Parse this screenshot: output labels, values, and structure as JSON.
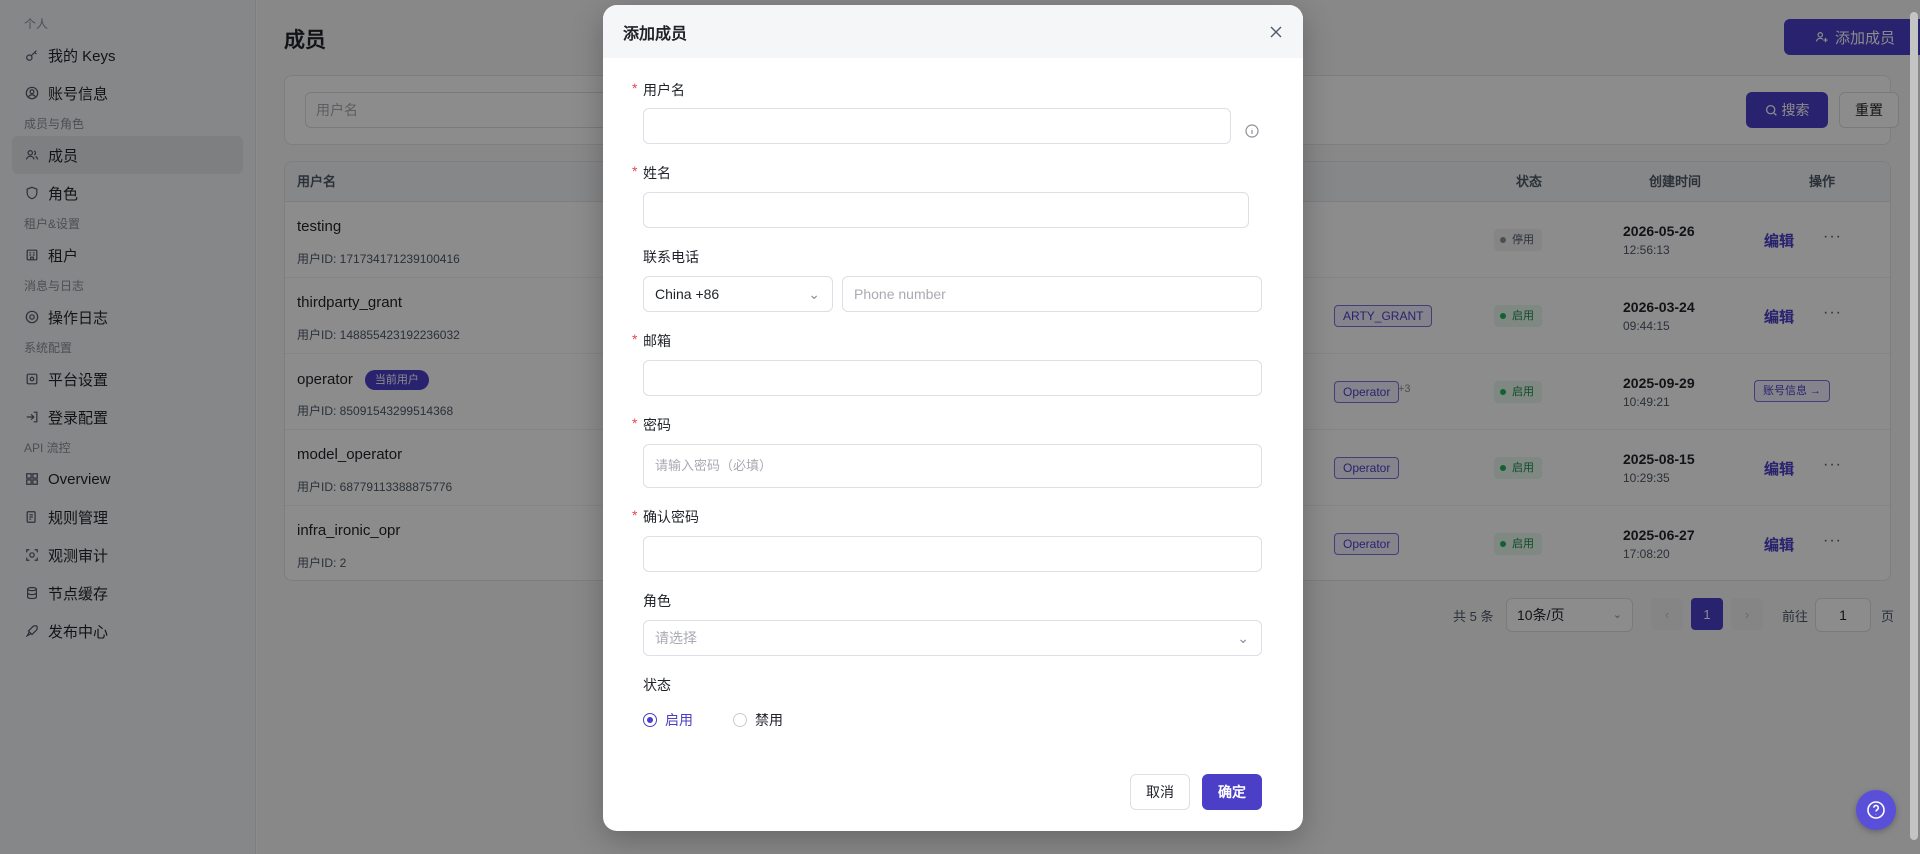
{
  "sidebar": {
    "groups": [
      {
        "label": "个人",
        "items": [
          {
            "label": "我的 Keys",
            "icon": "key-icon"
          },
          {
            "label": "账号信息",
            "icon": "user-circle-icon"
          }
        ]
      },
      {
        "label": "成员与角色",
        "items": [
          {
            "label": "成员",
            "icon": "users-icon",
            "active": true
          },
          {
            "label": "角色",
            "icon": "shield-icon"
          }
        ]
      },
      {
        "label": "租户&设置",
        "items": [
          {
            "label": "租户",
            "icon": "building-icon"
          }
        ]
      },
      {
        "label": "消息与日志",
        "items": [
          {
            "label": "操作日志",
            "icon": "log-icon"
          }
        ]
      },
      {
        "label": "系统配置",
        "items": [
          {
            "label": "平台设置",
            "icon": "settings-icon"
          },
          {
            "label": "登录配置",
            "icon": "login-icon"
          }
        ]
      },
      {
        "label": "API 流控",
        "items": [
          {
            "label": "Overview",
            "icon": "grid-icon"
          },
          {
            "label": "规则管理",
            "icon": "rules-icon"
          },
          {
            "label": "观测审计",
            "icon": "audit-icon"
          },
          {
            "label": "节点缓存",
            "icon": "database-icon"
          },
          {
            "label": "发布中心",
            "icon": "rocket-icon"
          }
        ]
      }
    ]
  },
  "main": {
    "title": "成员",
    "add_button": "添加成员",
    "filter": {
      "username_placeholder": "用户名",
      "search": "搜索",
      "reset": "重置"
    },
    "columns": {
      "username": "用户名",
      "status": "状态",
      "created": "创建时间",
      "actions": "操作"
    },
    "rows": [
      {
        "username": "testing",
        "uid": "用户ID:  171734171239100416",
        "role": "",
        "extra": "",
        "status": "停用",
        "enabled": false,
        "date": "2026-05-26",
        "time": "12:56:13",
        "action": "编辑"
      },
      {
        "username": "thirdparty_grant",
        "uid": "用户ID:  148855423192236032",
        "role": "ARTY_GRANT",
        "extra": "",
        "status": "启用",
        "enabled": true,
        "date": "2026-03-24",
        "time": "09:44:15",
        "action": "编辑"
      },
      {
        "username": "operator",
        "uid": "用户ID:  85091543299514368",
        "tag": "当前用户",
        "role": "Operator",
        "extra": "+3",
        "status": "启用",
        "enabled": true,
        "date": "2025-09-29",
        "time": "10:49:21",
        "action": "账号信息 →"
      },
      {
        "username": "model_operator",
        "uid": "用户ID:  68779113388875776",
        "role": "Operator",
        "extra": "",
        "status": "启用",
        "enabled": true,
        "date": "2025-08-15",
        "time": "10:29:35",
        "action": "编辑"
      },
      {
        "username": "infra_ironic_opr",
        "uid": "用户ID:  2",
        "role": "Operator",
        "extra": "",
        "status": "启用",
        "enabled": true,
        "date": "2025-06-27",
        "time": "17:08:20",
        "action": "编辑"
      }
    ],
    "pagination": {
      "total": "共 5 条",
      "page_size": "10条/页",
      "current": "1",
      "goto_label": "前往",
      "goto_value": "1",
      "goto_unit": "页"
    }
  },
  "modal": {
    "title": "添加成员",
    "fields": {
      "username": {
        "label": "用户名",
        "value": ""
      },
      "name": {
        "label": "姓名",
        "value": ""
      },
      "phone": {
        "label": "联系电话",
        "country": "China +86",
        "placeholder": "Phone number"
      },
      "email": {
        "label": "邮箱",
        "value": ""
      },
      "password": {
        "label": "密码",
        "placeholder": "请输入密码（必填）"
      },
      "confirm": {
        "label": "确认密码",
        "value": ""
      },
      "role": {
        "label": "角色",
        "placeholder": "请选择"
      },
      "status": {
        "label": "状态",
        "options": [
          "启用",
          "禁用"
        ],
        "selected": "启用"
      }
    },
    "cancel": "取消",
    "ok": "确定"
  },
  "colors": {
    "accent": "#4b3fc8",
    "required": "#e5484d"
  }
}
